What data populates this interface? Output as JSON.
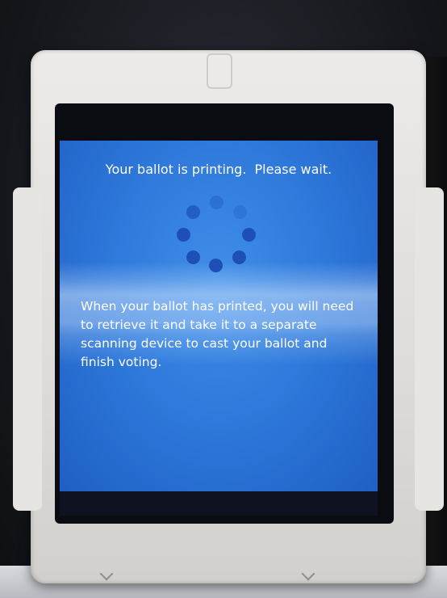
{
  "screen": {
    "title": "Your ballot is printing.  Please wait.",
    "body": "When your ballot has printed, you will need to retrieve it and take it to a separate scanning device to cast your ballot and finish voting.",
    "spinner_icon": "loading-spinner-icon"
  },
  "colors": {
    "screen_background": "#2f7adc",
    "text": "#ffffff",
    "spinner_dot": "#1d4fb7",
    "case": "#e6e5e2"
  }
}
